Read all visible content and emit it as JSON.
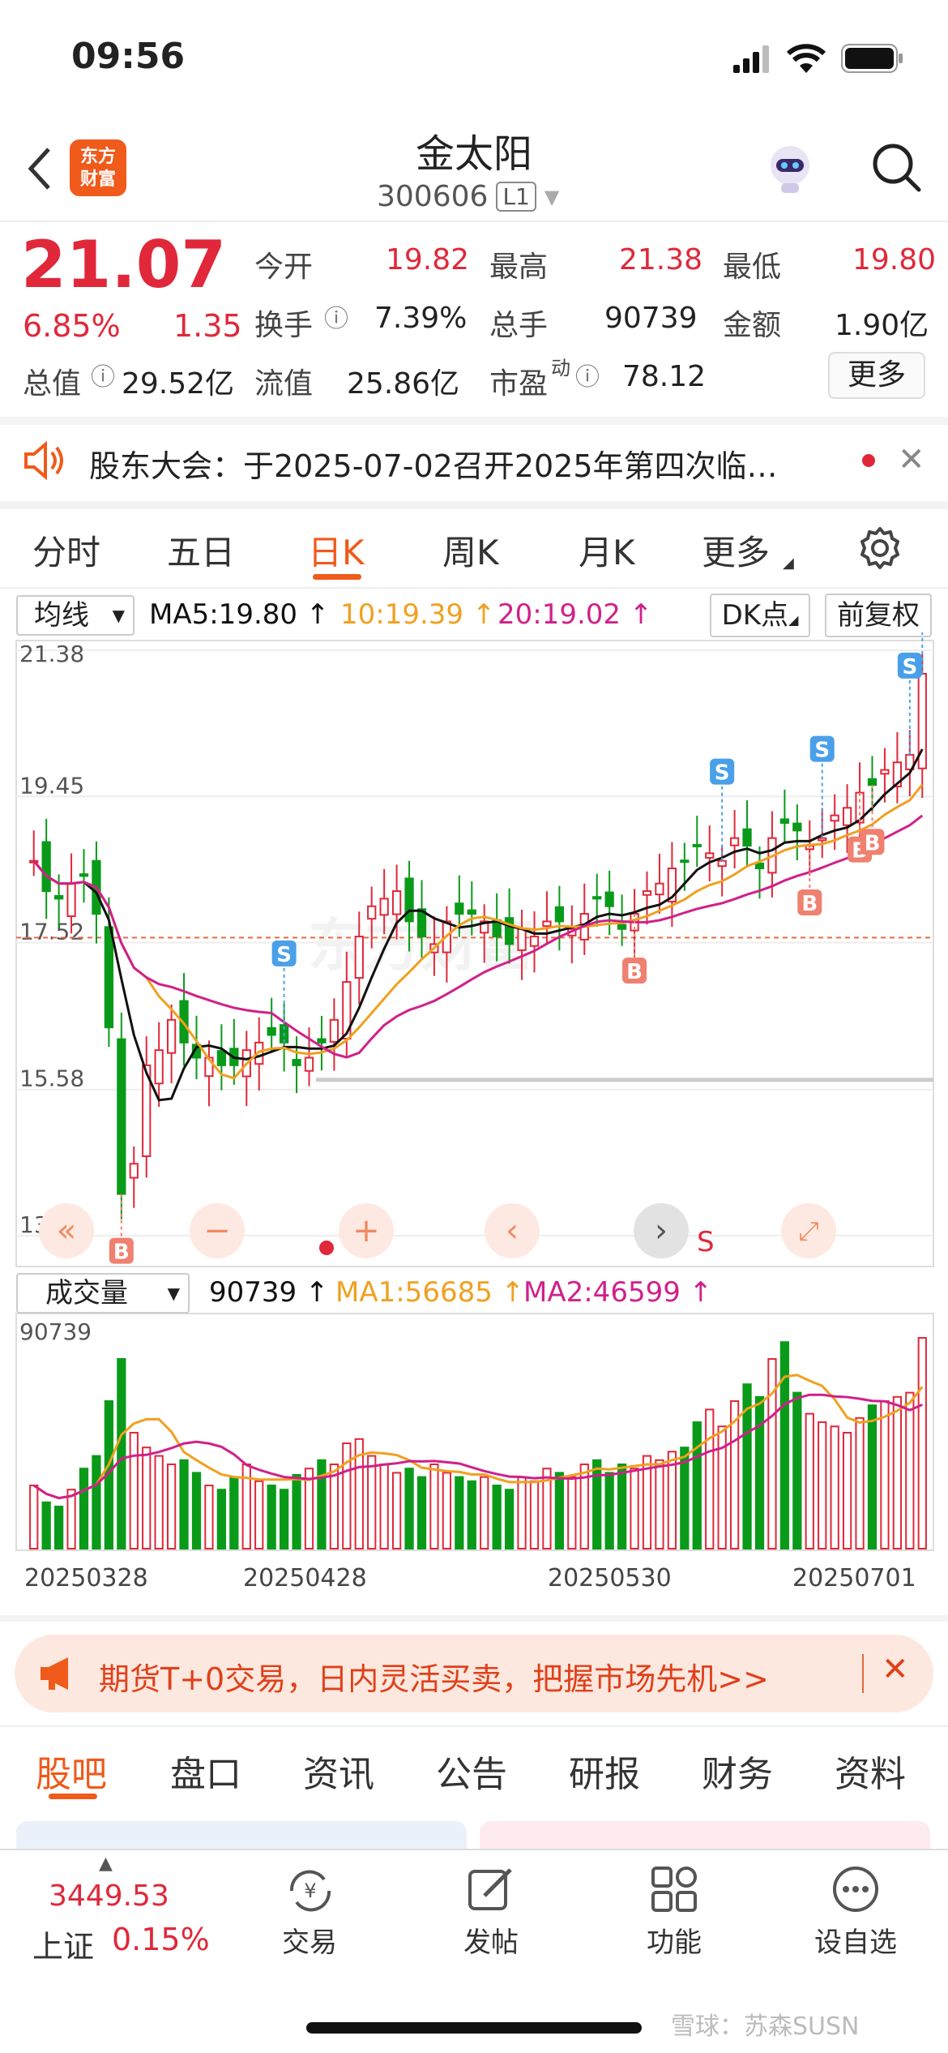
{
  "status": {
    "time": "09:56"
  },
  "header": {
    "name": "金太阳",
    "code": "300606",
    "level": "L1"
  },
  "quote": {
    "price": "21.07",
    "pct": "6.85%",
    "change": "1.35",
    "labels": {
      "open": "今开",
      "high": "最高",
      "low": "最低",
      "turnover": "换手",
      "vol": "总手",
      "amount": "金额",
      "mcap": "总值",
      "float": "流值",
      "pe": "市盈",
      "pe_sup": "动"
    },
    "values": {
      "open": "19.82",
      "high": "21.38",
      "low": "19.80",
      "turnover": "7.39%",
      "vol": "90739",
      "amount": "1.90亿",
      "mcap": "29.52亿",
      "float": "25.86亿",
      "pe": "78.12"
    },
    "more": "更多"
  },
  "notice": {
    "text": "股东大会：于2025-07-02召开2025年第四次临…"
  },
  "tabs": [
    "分时",
    "五日",
    "日K",
    "周K",
    "月K",
    "更多"
  ],
  "ma_bar": {
    "select": "均线",
    "ma5": "MA5:19.80",
    "ma10": "10:19.39",
    "ma20": "20:19.02",
    "dk": "DK点",
    "fq": "前复权"
  },
  "price_axis": [
    "21.38",
    "19.45",
    "17.52",
    "15.58",
    "13.65"
  ],
  "vol_bar": {
    "select": "成交量",
    "vol": "90739",
    "ma1": "MA1:56685",
    "ma2": "MA2:46599",
    "axis_max": "90739"
  },
  "dates": [
    "20250328",
    "20250428",
    "20250530",
    "20250701"
  ],
  "signal_label": "S",
  "banner": {
    "text": "期货T+0交易，日内灵活买卖，把握市场先机>>"
  },
  "bottom_tabs": [
    "股吧",
    "盘口",
    "资讯",
    "公告",
    "研报",
    "财务",
    "资料"
  ],
  "dock": {
    "index_value": "3449.53",
    "index_name": "上证",
    "index_pct": "0.15%",
    "trade": "交易",
    "post": "发帖",
    "func": "功能",
    "watch": "设自选"
  },
  "watermark": "雪球：苏森SUSN",
  "colors": {
    "up": "#e0283a",
    "down": "#0a9a1a",
    "ma5": "#111111",
    "ma10": "#f0a020",
    "ma20": "#d0208a",
    "accent": "#f05a1a"
  },
  "chart_data": {
    "type": "candlestick",
    "ylim": [
      13.65,
      21.38
    ],
    "ma": {
      "ma5": 19.8,
      "ma10": 19.39,
      "ma20": 19.02
    },
    "last": {
      "open": 19.82,
      "high": 21.38,
      "low": 19.8,
      "close": 21.07,
      "volume": 90739
    },
    "volume_ma": {
      "ma1": 56685,
      "ma2": 46599
    }
  }
}
